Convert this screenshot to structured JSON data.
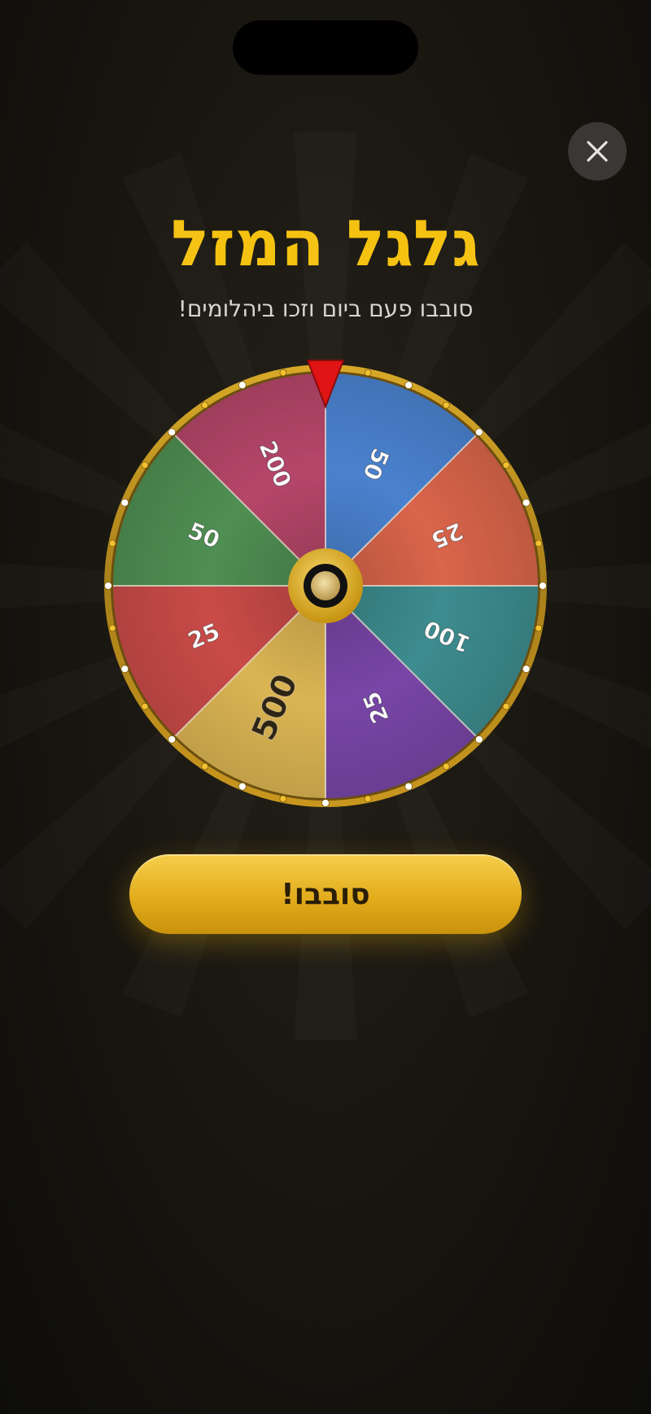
{
  "game": {
    "title": "גלגל המזל",
    "subtitle": "סובבו פעם ביום וזכו ביהלומים!",
    "spin_label": "סובבו!",
    "close_icon": "close-icon",
    "pointer_icon": "pointer-triangle-icon",
    "accent_color": "#f5c211",
    "pointer_color": "#e01414"
  },
  "wheel": {
    "segments": [
      {
        "label": "50",
        "color": "#4a82cf",
        "text_color": "#ffffff"
      },
      {
        "label": "25",
        "color": "#d9654a",
        "text_color": "#ffffff"
      },
      {
        "label": "100",
        "color": "#3d8c8f",
        "text_color": "#ffffff"
      },
      {
        "label": "25",
        "color": "#7846a6",
        "text_color": "#ffffff"
      },
      {
        "label": "500",
        "color": "#dbb553",
        "text_color": "#2e2414"
      },
      {
        "label": "25",
        "color": "#c94b48",
        "text_color": "#ffffff"
      },
      {
        "label": "50",
        "color": "#4f8f52",
        "text_color": "#ffffff"
      },
      {
        "label": "200",
        "color": "#b5466a",
        "text_color": "#ffffff"
      }
    ]
  }
}
